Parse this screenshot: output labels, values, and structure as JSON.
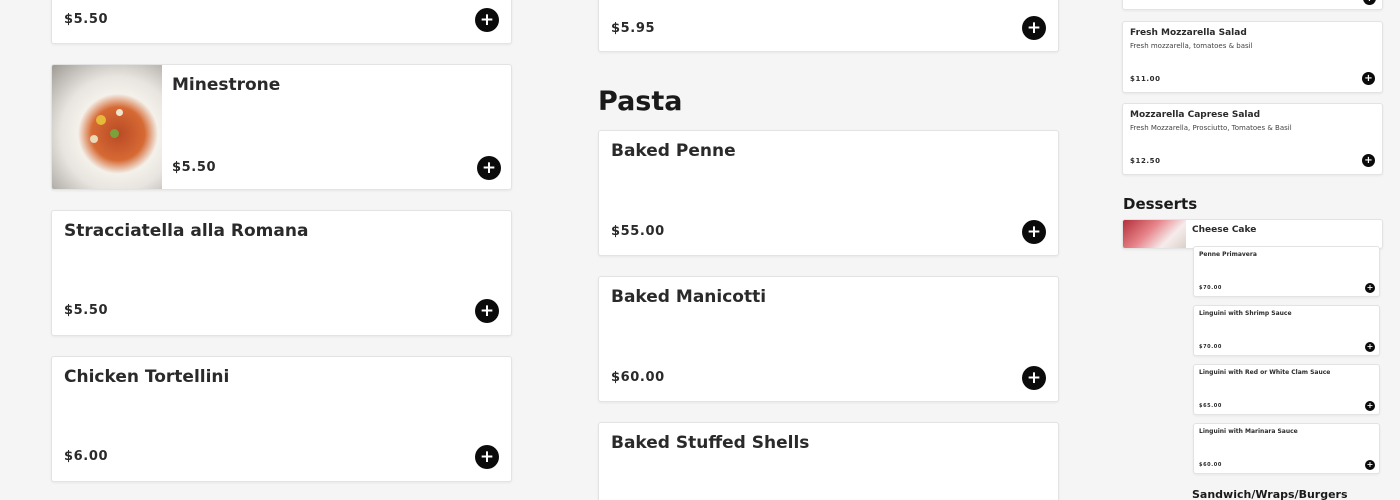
{
  "column1": {
    "items": [
      {
        "price": "$5.50"
      },
      {
        "name": "Minestrone",
        "price": "$5.50",
        "image": "soup-bowl-image"
      },
      {
        "name": "Stracciatella alla Romana",
        "price": "$5.50"
      },
      {
        "name": "Chicken Tortellini",
        "price": "$6.00"
      }
    ]
  },
  "column2": {
    "top_item": {
      "price": "$5.95"
    },
    "section_title": "Pasta",
    "items": [
      {
        "name": "Baked Penne",
        "price": "$55.00"
      },
      {
        "name": "Baked Manicotti",
        "price": "$60.00"
      },
      {
        "name": "Baked Stuffed Shells"
      }
    ]
  },
  "column3": {
    "items": [
      {
        "name": "Fresh Mozzarella Salad",
        "desc": "Fresh mozzarella, tomatoes & basil",
        "price": "$11.00"
      },
      {
        "name": "Mozzarella Caprese Salad",
        "desc": "Fresh Mozzarella, Prosciutto, Tomatoes & Basil",
        "price": "$12.50"
      }
    ],
    "desserts_title": "Desserts",
    "dessert_item": {
      "name": "Cheese Cake"
    },
    "overlay_items": [
      {
        "name": "Penne Primavera",
        "price": "$70.00"
      },
      {
        "name": "Linguini with Shrimp Sauce",
        "price": "$70.00"
      },
      {
        "name": "Linguini with Red or White Clam Sauce",
        "price": "$65.00"
      },
      {
        "name": "Linguini with Marinara Sauce",
        "price": "$60.00"
      }
    ],
    "sandwich_title": "Sandwich/Wraps/Burgers"
  },
  "add_icon": "plus-icon",
  "add_symbol": "+",
  "colors": {
    "button": "#0b0b0b",
    "card": "#ffffff",
    "background": "#f5f5f5"
  }
}
